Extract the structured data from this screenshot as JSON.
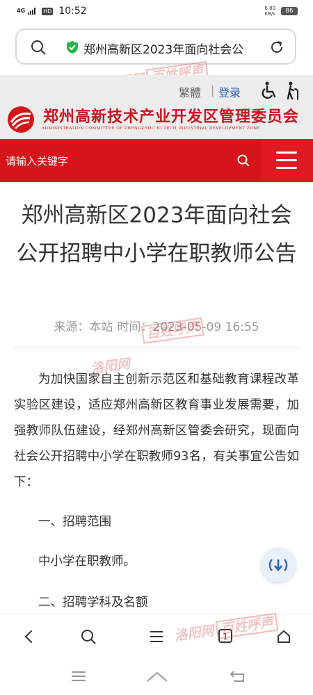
{
  "status_bar": {
    "network": "4G",
    "hd": "HD",
    "time": "10:52",
    "speed_value": "6.80",
    "speed_unit": "KB/s",
    "battery": "86"
  },
  "browser": {
    "url_text": "郑州高新区2023年面向社会公"
  },
  "watermarks": {
    "text": "洛阳网",
    "box_text": "百姓呼声"
  },
  "site": {
    "lang_switch": "繁體",
    "separator": "|",
    "login": "登录",
    "name": "郑州高新技术产业开发区管理委员会",
    "name_en": "ADMINISTRATION COMMITTEE OF ZHENGZHOU HI-TECH INDUSTRIAL DEVELOPMENT ZONE",
    "brand_color": "#d6151a"
  },
  "search": {
    "placeholder": "请输入关键字"
  },
  "article": {
    "title": "郑州高新区2023年面向社会公开招聘中小学在职教师公告",
    "source_label": "来源：",
    "source": "本站",
    "time_label": "时间：",
    "time": "2023-05-09 16:55",
    "intro": "为加快国家自主创新示范区和基础教育课程改革实验区建设，适应郑州高新区教育事业发展需要，加强教师队伍建设，经郑州高新区管委会研究，现面向社会公开招聘中小学在职教师93名，有关事宜公告如下：",
    "section1_heading": "一、招聘范围",
    "section1_body": "中小学在职教师。",
    "section2_heading": "二、招聘学科及名额"
  },
  "toolbar": {
    "tab_count": "1"
  },
  "icons": {
    "search": "search-icon",
    "shield": "shield-check-icon",
    "reload": "reload-icon",
    "accessibility": "wheelchair-icon",
    "elder_mode": "elderly-icon",
    "menu": "menu-icon",
    "audio": "audio-download-icon",
    "back": "back-icon",
    "home": "home-icon",
    "recent": "recent-apps-icon",
    "sys_back": "system-back-icon"
  }
}
